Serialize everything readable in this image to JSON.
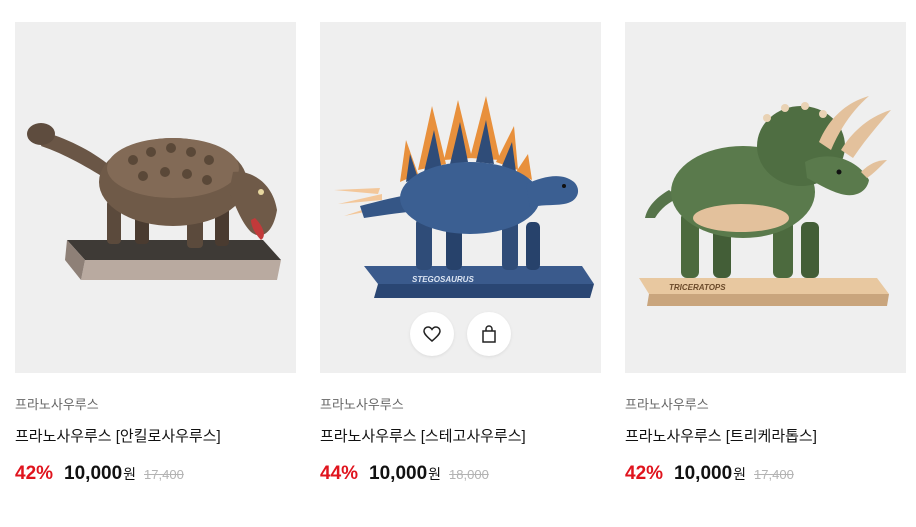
{
  "products": [
    {
      "image_alt": "안킬로사우루스 figure",
      "brand": "프라노사우루스",
      "name": "프라노사우루스 [안킬로사우루스]",
      "discount": "42%",
      "price": "10,000",
      "currency": "원",
      "original_price": "17,400"
    },
    {
      "image_alt": "스테고사우루스 figure",
      "base_label": "STEGOSAURUS",
      "brand": "프라노사우루스",
      "name": "프라노사우루스 [스테고사우루스]",
      "discount": "44%",
      "price": "10,000",
      "currency": "원",
      "original_price": "18,000",
      "actions": {
        "wishlist_icon": "heart-icon",
        "cart_icon": "shopping-bag-icon"
      }
    },
    {
      "image_alt": "트리케라톱스 figure",
      "base_label": "TRICERATOPS",
      "brand": "프라노사우루스",
      "name": "프라노사우루스 [트리케라톱스]",
      "discount": "42%",
      "price": "10,000",
      "currency": "원",
      "original_price": "17,400"
    }
  ],
  "colors": {
    "discount": "#e0141e",
    "thumb_bg": "#efefef",
    "strike_price": "#b3b3b3"
  }
}
